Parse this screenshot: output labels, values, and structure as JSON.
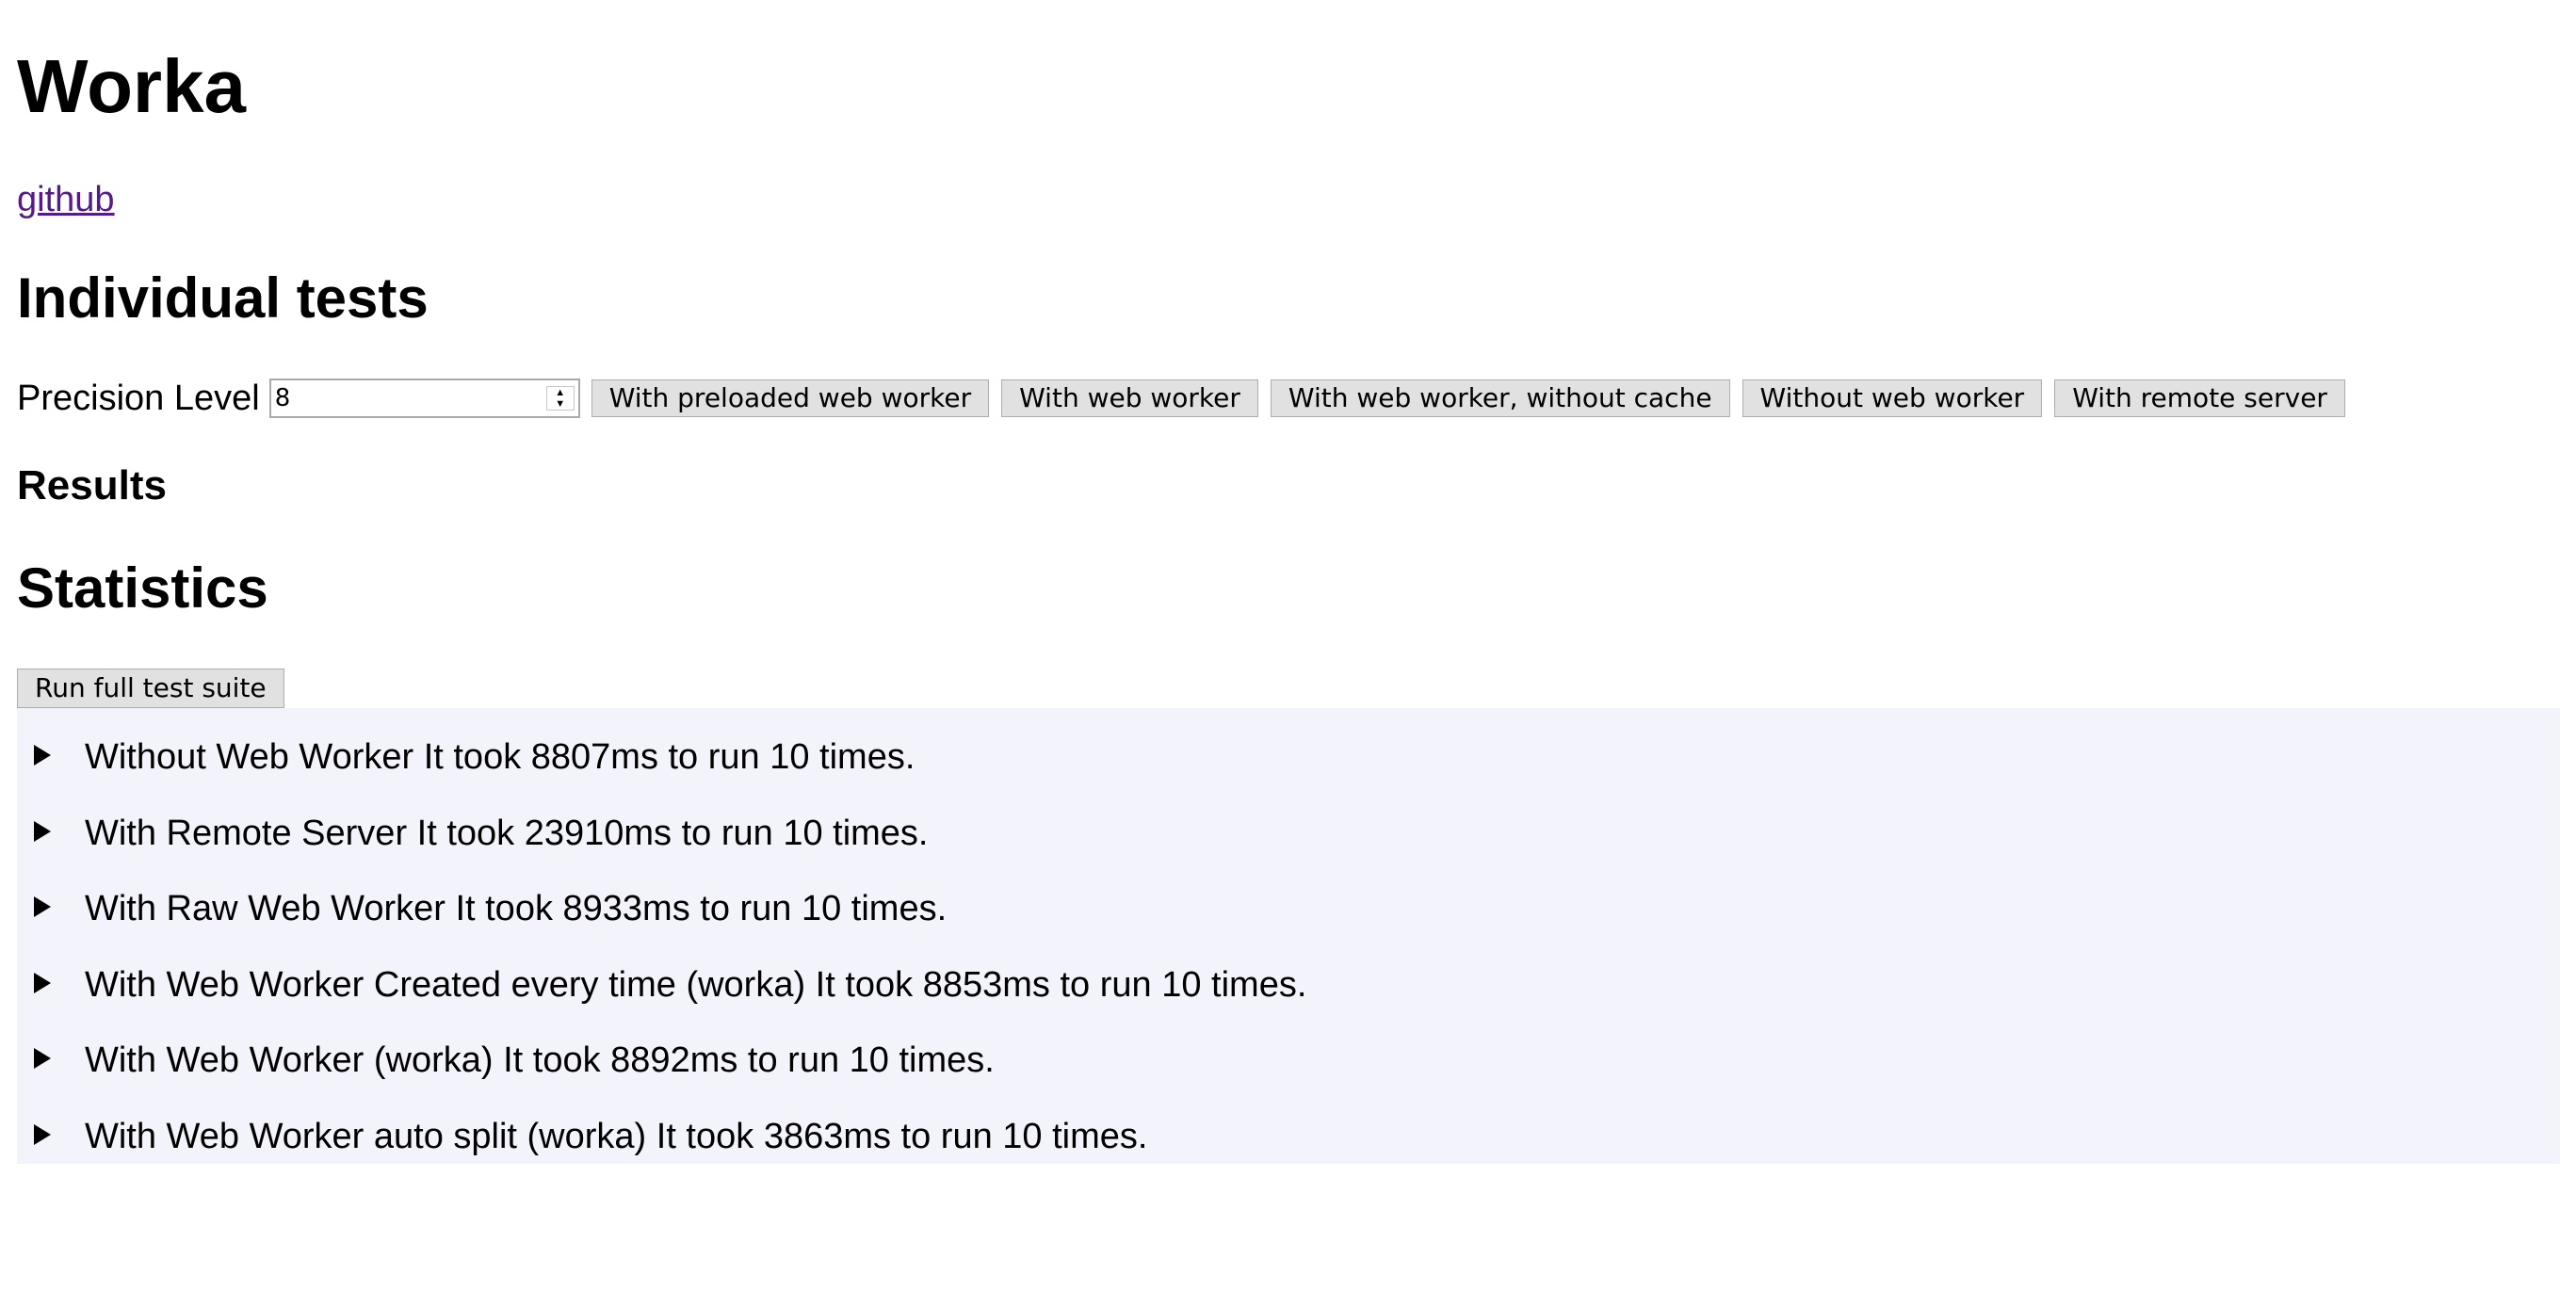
{
  "header": {
    "title": "Worka",
    "link_label": "github"
  },
  "individual": {
    "heading": "Individual tests",
    "precision_label": "Precision Level",
    "precision_value": "8",
    "buttons": [
      "With preloaded web worker",
      "With web worker",
      "With web worker, without cache",
      "Without web worker",
      "With remote server"
    ]
  },
  "results": {
    "heading": "Results"
  },
  "statistics": {
    "heading": "Statistics",
    "run_label": "Run full test suite",
    "items": [
      "Without Web Worker It took 8807ms to run 10 times.",
      "With Remote Server It took 23910ms to run 10 times.",
      "With Raw Web Worker It took 8933ms to run 10 times.",
      "With Web Worker Created every time (worka) It took 8853ms to run 10 times.",
      "With Web Worker (worka) It took 8892ms to run 10 times.",
      "With Web Worker auto split (worka) It took 3863ms to run 10 times."
    ]
  },
  "colors": {
    "link_visited": "#551a8b",
    "stats_background": "#f3f3fc",
    "button_background": "#e1e1e1"
  },
  "icons": {
    "disclosure": "disclosure-triangle-right-icon",
    "spinner": "spinner-arrows-icon"
  }
}
